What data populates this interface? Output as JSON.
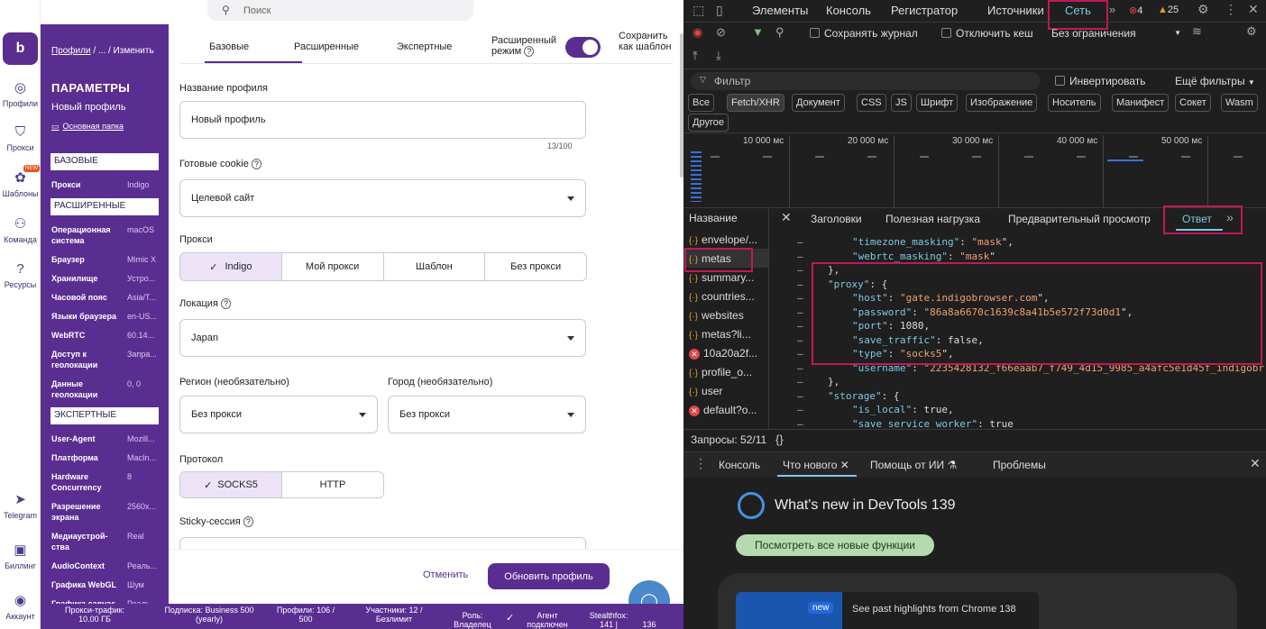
{
  "search": {
    "placeholder": "Поиск"
  },
  "rail": {
    "logo": "b",
    "items": [
      {
        "label": "Профили"
      },
      {
        "label": "Прокси"
      },
      {
        "label": "Шаблоны",
        "badge": "NEW"
      },
      {
        "label": "Команда"
      },
      {
        "label": "Ресурсы"
      },
      {
        "label": "Telegram"
      },
      {
        "label": "Биллинг"
      },
      {
        "label": "Аккаунт"
      }
    ]
  },
  "panel": {
    "crumb_root": "Профили",
    "crumb_rest": " / ... / Изменить",
    "title": "ПАРАМЕТРЫ",
    "profile_name": "Новый профиль",
    "folder": "Основная папка",
    "sections": {
      "basic": "БАЗОВЫЕ",
      "advanced": "РАСШИРЕННЫЕ",
      "expert": "ЭКСПЕРТНЫЕ"
    },
    "rows": [
      {
        "k": "Прокси",
        "v": "Indigo"
      },
      {
        "k": "Операционная система",
        "v": "macOS"
      },
      {
        "k": "Браузер",
        "v": "Mimic X"
      },
      {
        "k": "Хранилище",
        "v": "Устро..."
      },
      {
        "k": "Часовой пояс",
        "v": "Asia/T..."
      },
      {
        "k": "Языки браузера",
        "v": "en-US..."
      },
      {
        "k": "WebRTC",
        "v": "60.14..."
      },
      {
        "k": "Доступ к геолокации",
        "v": "Запра..."
      },
      {
        "k": "Данные геолокации",
        "v": "0, 0"
      },
      {
        "k": "User-Agent",
        "v": "Mozill..."
      },
      {
        "k": "Платформа",
        "v": "MacIn..."
      },
      {
        "k": "Hardware Concurrency",
        "v": "8"
      },
      {
        "k": "Разрешение экрана",
        "v": "2560x..."
      },
      {
        "k": "Медиаустрой-ства",
        "v": "Real"
      },
      {
        "k": "AudioContext",
        "v": "Реаль..."
      },
      {
        "k": "Графика WebGL",
        "v": "Шум"
      },
      {
        "k": "Графика canvas",
        "v": "Реаль..."
      }
    ]
  },
  "main": {
    "tabs": [
      "Базовые",
      "Расширенные",
      "Экспертные"
    ],
    "adv_mode": "Расширенный режим",
    "save_template": "Сохранить как шаблон",
    "profile_name_label": "Название профиля",
    "profile_name_value": "Новый профиль",
    "counter": "13/100",
    "cookies_label": "Готовые cookie",
    "cookies_value": "Целевой сайт",
    "proxy_label": "Прокси",
    "proxy_options": [
      "Indigo",
      "Мой прокси",
      "Шаблон",
      "Без прокси"
    ],
    "location_label": "Локация",
    "location_value": "Japan",
    "region_label": "Регион (необязательно)",
    "region_value": "Без прокси",
    "city_label": "Город (необязательно)",
    "city_value": "Без прокси",
    "protocol_label": "Протокол",
    "protocol_options": [
      "SOCKS5",
      "HTTP"
    ],
    "sticky_label": "Sticky-сессия",
    "cancel": "Отменить",
    "update": "Обновить профиль"
  },
  "status": [
    "Прокси-трафик: 10.00 ГБ",
    "Подписка: Business 500 (yearly)",
    "Профили: 106 / 500",
    "Участники: 12 / Безлимит",
    "Роль: Владелец",
    "Агент подключен",
    "Stealthfox: 141 |",
    "136"
  ],
  "devtools": {
    "tabs": [
      "Элементы",
      "Консоль",
      "Регистратор",
      "Источники",
      "Сеть"
    ],
    "errors": "4",
    "warnings": "25",
    "preserve_log": "Сохранять журнал",
    "disable_cache": "Отключить кеш",
    "throttle": "Без ограничения",
    "filter_placeholder": "Фильтр",
    "invert": "Инвертировать",
    "more_filters": "Ещё фильтры",
    "chips": [
      "Все",
      "Fetch/XHR",
      "Документ",
      "CSS",
      "JS",
      "Шрифт",
      "Изображение",
      "Носитель",
      "Манифест",
      "Сокет",
      "Wasm",
      "Другое"
    ],
    "timeline": [
      "10 000 мс",
      "20 000 мс",
      "30 000 мс",
      "40 000 мс",
      "50 000 мс"
    ],
    "name_col": "Название",
    "detail_tabs": [
      "Заголовки",
      "Полезная нагрузка",
      "Предварительный просмотр",
      "Ответ"
    ],
    "requests": [
      {
        "n": "envelope/...",
        "t": "json"
      },
      {
        "n": "metas",
        "t": "json"
      },
      {
        "n": "summary...",
        "t": "json"
      },
      {
        "n": "countries...",
        "t": "json"
      },
      {
        "n": "websites",
        "t": "json"
      },
      {
        "n": "metas?li...",
        "t": "json"
      },
      {
        "n": "10a20a2f...",
        "t": "err"
      },
      {
        "n": "profile_o...",
        "t": "json"
      },
      {
        "n": "user",
        "t": "json"
      },
      {
        "n": "default?o...",
        "t": "err"
      }
    ],
    "requests_count": "Запросы: 52/11",
    "code": [
      {
        "i": 1,
        "t": "\"timezone_masking\": \"mask\","
      },
      {
        "i": 1,
        "t": "\"webrtc_masking\": \"mask\""
      },
      {
        "i": 0,
        "t": "},"
      },
      {
        "i": 0,
        "t": "\"proxy\": {"
      },
      {
        "i": 1,
        "t": "\"host\": \"gate.indigobrowser.com\","
      },
      {
        "i": 1,
        "t": "\"password\": \"86a8a6670c1639c8a41b5e572f73d0d1\","
      },
      {
        "i": 1,
        "t": "\"port\": 1080,"
      },
      {
        "i": 1,
        "t": "\"save_traffic\": false,"
      },
      {
        "i": 1,
        "t": "\"type\": \"socks5\","
      },
      {
        "i": 1,
        "t": "\"username\": \"2235428132_f66eaab7_f749_4d15_9985_a4afc5e1d45f_indigobr"
      },
      {
        "i": 0,
        "t": "},"
      },
      {
        "i": 0,
        "t": "\"storage\": {"
      },
      {
        "i": 1,
        "t": "\"is_local\": true,"
      },
      {
        "i": 1,
        "t": "\"save_service_worker\": true"
      },
      {
        "i": 0,
        "t": "}"
      }
    ],
    "braces": "{}",
    "console_tabs": [
      "Консоль",
      "Что нового",
      "Помощь от ИИ",
      "Проблемы"
    ],
    "whats_new": "What's new in DevTools 139",
    "see_all": "Посмотреть все новые функции",
    "new_badge": "new",
    "highlights": "See past highlights from Chrome 138"
  }
}
